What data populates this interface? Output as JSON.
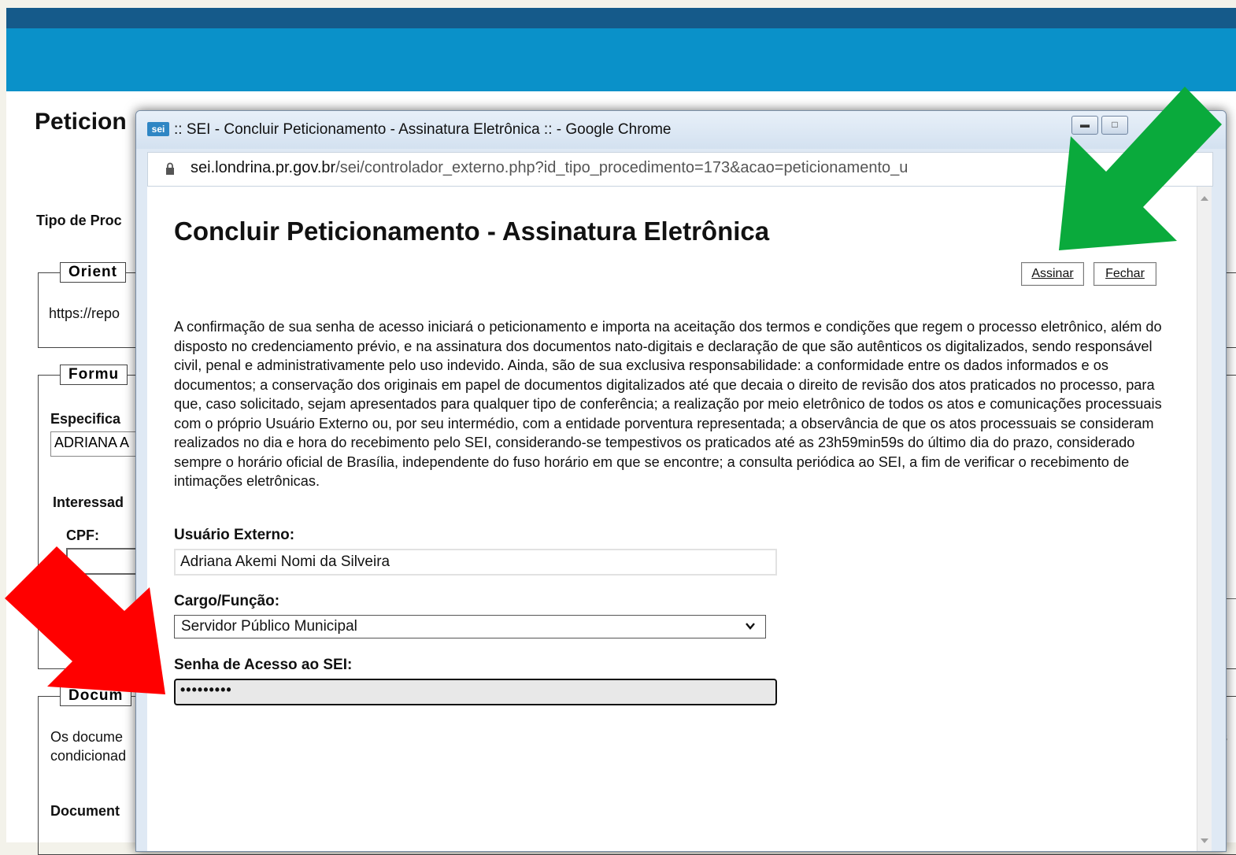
{
  "background": {
    "page_title": "Peticion",
    "tipo_label": "Tipo de Proc",
    "fieldset_orient": "Orient",
    "orient_url": "https://repo",
    "fieldset_formu": "Formu",
    "especifica_label": "Especifica",
    "especifica_value": "ADRIANA A",
    "interessad_label": "Interessad",
    "cpf_label": "CPF:",
    "fieldset_docum": "Docum",
    "docs_text_1": "Os docume",
    "docs_text_2": "condicionad",
    "docs_right_fragment": "is",
    "document_label": "Document"
  },
  "window": {
    "logo": "sei",
    "title": ":: SEI - Concluir Peticionamento - Assinatura Eletrônica :: - Google Chrome",
    "url_domain": "sei.londrina.pr.gov.br",
    "url_path": "/sei/controlador_externo.php?id_tipo_procedimento=173&acao=peticionamento_u"
  },
  "form": {
    "heading": "Concluir Peticionamento - Assinatura Eletrônica",
    "sign_button": "Assinar",
    "close_button": "Fechar",
    "notice": "A confirmação de sua senha de acesso iniciará o peticionamento e importa na aceitação dos termos e condições que regem o processo eletrônico, além do disposto no credenciamento prévio, e na assinatura dos documentos nato-digitais e declaração de que são autênticos os digitalizados, sendo responsável civil, penal e administrativamente pelo uso indevido. Ainda, são de sua exclusiva responsabilidade: a conformidade entre os dados informados e os documentos; a conservação dos originais em papel de documentos digitalizados até que decaia o direito de revisão dos atos praticados no processo, para que, caso solicitado, sejam apresentados para qualquer tipo de conferência; a realização por meio eletrônico de todos os atos e comunicações processuais com o próprio Usuário Externo ou, por seu intermédio, com a entidade porventura representada; a observância de que os atos processuais se consideram realizados no dia e hora do recebimento pelo SEI, considerando-se tempestivos os praticados até as 23h59min59s do último dia do prazo, considerado sempre o horário oficial de Brasília, independente do fuso horário em que se encontre; a consulta periódica ao SEI, a fim de verificar o recebimento de intimações eletrônicas.",
    "user_label": "Usuário Externo:",
    "user_value": "Adriana Akemi Nomi da Silveira",
    "cargo_label": "Cargo/Função:",
    "cargo_value": "Servidor Público Municipal",
    "senha_label": "Senha de Acesso ao SEI:",
    "senha_value": "•••••••••"
  },
  "colors": {
    "header": "#0a91c9",
    "header_dark": "#155a8a",
    "arrow_green": "#0aaa3c",
    "arrow_red": "#ff0000"
  }
}
